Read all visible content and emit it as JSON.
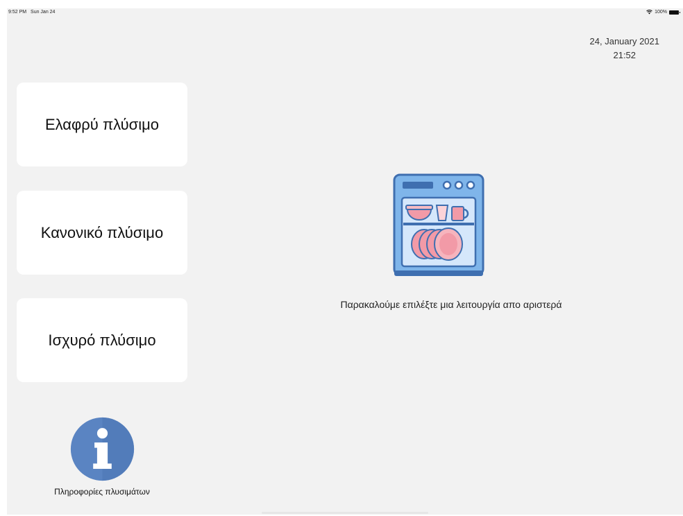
{
  "status_bar": {
    "time": "9:52 PM",
    "date": "Sun Jan 24",
    "wifi_icon": "wifi-icon",
    "battery_percent": "100%",
    "battery_icon": "battery-icon"
  },
  "header": {
    "date": "24, January 2021",
    "time": "21:52"
  },
  "modes": [
    {
      "label": "Ελαφρύ πλύσιμο"
    },
    {
      "label": "Κανονικό πλύσιμο"
    },
    {
      "label": "Ισχυρό πλύσιμο"
    }
  ],
  "info": {
    "icon": "info-icon",
    "label": "Πληροφορίες πλυσιμάτων"
  },
  "main": {
    "illustration": "dishwasher-icon",
    "prompt": "Παρακαλούμε επιλέξτε μια λειτουργία απο αριστερά"
  },
  "colors": {
    "background": "#f2f2f2",
    "card": "#ffffff",
    "info_blue": "#5a84c2",
    "dishwasher_blue": "#7fb5ea",
    "dishwasher_outline": "#3f6fb0",
    "plate_pink": "#f2a7b0"
  }
}
